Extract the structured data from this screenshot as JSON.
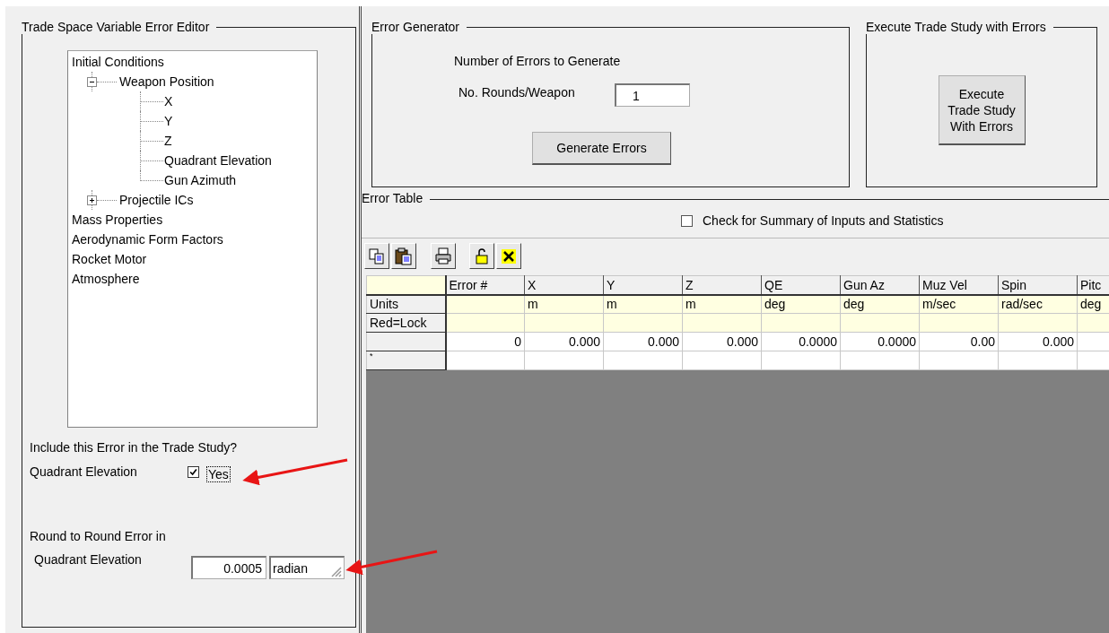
{
  "editor": {
    "title": "Trade Space Variable Error Editor",
    "tree": [
      {
        "label": "Initial Conditions",
        "children": [
          {
            "label": "Weapon Position",
            "expanded": true,
            "children": [
              {
                "label": "X"
              },
              {
                "label": "Y"
              },
              {
                "label": "Z"
              },
              {
                "label": "Quadrant Elevation"
              },
              {
                "label": "Gun Azimuth"
              }
            ]
          },
          {
            "label": "Projectile ICs",
            "expanded": false
          }
        ]
      },
      {
        "label": "Mass Properties"
      },
      {
        "label": "Aerodynamic Form Factors"
      },
      {
        "label": "Rocket Motor"
      },
      {
        "label": "Atmosphere"
      }
    ],
    "include_prompt": "Include this Error in the Trade Study?",
    "include_label": "Quadrant Elevation",
    "include_checkbox": {
      "label": "Yes",
      "checked": true
    },
    "error_heading": "Round to Round Error in",
    "error_label": "Quadrant Elevation",
    "error_value": "0.0005",
    "error_unit": "radian"
  },
  "generator": {
    "title": "Error Generator",
    "heading": "Number of Errors to Generate",
    "rounds_label": "No. Rounds/Weapon",
    "rounds_value": "1",
    "button": "Generate Errors"
  },
  "execute": {
    "title": "Execute Trade Study with Errors",
    "button_lines": [
      "Execute",
      "Trade Study",
      "With Errors"
    ]
  },
  "error_table": {
    "title": "Error Table",
    "summary_checkbox": {
      "label": "Check for Summary of Inputs and Statistics",
      "checked": false
    },
    "columns": [
      "Error #",
      "X",
      "Y",
      "Z",
      "QE",
      "Gun Az",
      "Muz Vel",
      "Spin",
      "Pitc"
    ],
    "rows": [
      {
        "kind": "units",
        "header": "Units",
        "cells": [
          null,
          "m",
          "m",
          "m",
          "deg",
          "deg",
          "m/sec",
          "rad/sec",
          "deg"
        ]
      },
      {
        "kind": "lock",
        "header": "Red=Lock"
      },
      {
        "kind": "data",
        "cells": [
          "0",
          "0.000",
          "0.000",
          "0.000",
          "0.0000",
          "0.0000",
          "0.00",
          "0.000",
          null
        ]
      },
      {
        "kind": "new",
        "header": "*"
      }
    ]
  }
}
